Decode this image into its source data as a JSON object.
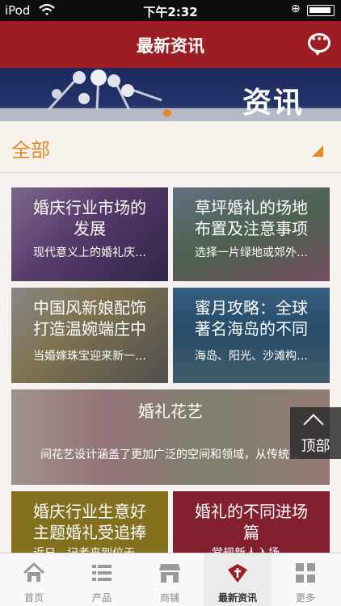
{
  "status_bar": {
    "carrier": "iPod",
    "time": "下午2:32"
  },
  "nav": {
    "title": "最新资讯",
    "action_icon": "chat-bubble-icon"
  },
  "banner": {
    "title": "资讯"
  },
  "filter": {
    "label": "全部",
    "accent_color": "#e0892b"
  },
  "cards": [
    {
      "title_line1": "婚庆行业市场的",
      "title_line2": "发展",
      "summary": "现代意义上的婚礼庆…"
    },
    {
      "title_line1": "草坪婚礼的场地",
      "title_line2": "布置及注意事项",
      "summary": "选择一片绿地或郊外…"
    },
    {
      "title_line1": "中国风新娘配饰",
      "title_line2": "打造温婉端庄中",
      "summary": "当婚嫁珠宝迎来新一…"
    },
    {
      "title_line1": "蜜月攻略：全球",
      "title_line2": "著名海岛的不同",
      "summary": "海岛、阳光、沙滩构…"
    },
    {
      "title_line1": "婚礼花艺",
      "title_line2": "",
      "summary": "间花艺设计涵盖了更加广泛的空间和领域，从传统…"
    },
    {
      "title_line1": "婚庆行业生意好",
      "title_line2": "主题婚礼受追捧",
      "summary": "近日，记者来到位于…"
    },
    {
      "title_line1": "婚礼的不同进场",
      "title_line2": "篇",
      "summary": "常规新人入场…"
    }
  ],
  "back_to_top": {
    "label": "顶部"
  },
  "tabs": [
    {
      "label": "首页",
      "icon": "home-icon"
    },
    {
      "label": "产品",
      "icon": "list-icon"
    },
    {
      "label": "商铺",
      "icon": "shop-icon"
    },
    {
      "label": "最新资讯",
      "icon": "news-icon",
      "active": true
    },
    {
      "label": "更多",
      "icon": "grid-icon"
    }
  ],
  "colors": {
    "brand": "#9c1e24",
    "status_bar": "#0e0e0e"
  }
}
